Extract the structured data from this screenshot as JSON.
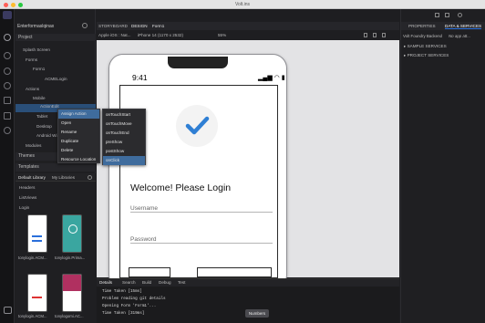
{
  "window": {
    "title": "Volt.ins"
  },
  "search": {
    "value": "Enterformaslqinax"
  },
  "left": {
    "project_label": "Project",
    "tree": [
      "Splash Screen",
      "Forms",
      "Form1",
      "ACMELogin",
      "Actions",
      "Mobile",
      "ActionEdit",
      "Tablet",
      "Desktop",
      "Android Wi...",
      "Modules"
    ],
    "themes": "Themes",
    "templates": "Templates"
  },
  "library": {
    "tabs": [
      "Default Library",
      "My Libraries"
    ],
    "items": [
      "Headers",
      "ListViews",
      "Login"
    ],
    "thumbs": [
      "tonylogin.ACM...",
      "tonylogin.Prima...",
      "tonylogin.ACM...",
      "tonylogomi.AC..."
    ]
  },
  "context_menu": {
    "items": [
      "Assign Action",
      "Open",
      "Rename",
      "Duplicate",
      "Delete",
      "Resource Location"
    ],
    "submenu": [
      "onTouchStart",
      "onTouchMove",
      "onTouchEnd",
      "preShow",
      "postShow",
      "onClick"
    ]
  },
  "editor": {
    "tabs": [
      "STORYBOARD",
      "DESIGN",
      "Form1"
    ],
    "platform": "Apple iOS : Nat...",
    "device": "iPhone 14 (1170 x 2532)",
    "zoom": "55%"
  },
  "phone": {
    "time": "9:41",
    "welcome": "Welcome! Please Login",
    "username": "Username",
    "password": "Password"
  },
  "bottom": {
    "tabs": [
      "Details",
      "Search",
      "Build",
      "Debug",
      "Test"
    ],
    "log": [
      "Time Taken [15ms]",
      "Problem reading git details",
      "Opening Form 'Form1'...",
      "Time Taken [319ms]"
    ],
    "tooltip": "Numbers"
  },
  "right": {
    "tabs": [
      "PROPERTIES",
      "DATA & SERVICES"
    ],
    "backend_label": "Volt Foundry Backend",
    "backend_value": "No app att...",
    "sections": [
      "SAMPLE SERVICES",
      "PROJECT SERVICES"
    ]
  },
  "colors": {
    "accent": "#2a6fdb",
    "check": "#2f7fd4",
    "menu_selected": "#3f6c9d"
  }
}
